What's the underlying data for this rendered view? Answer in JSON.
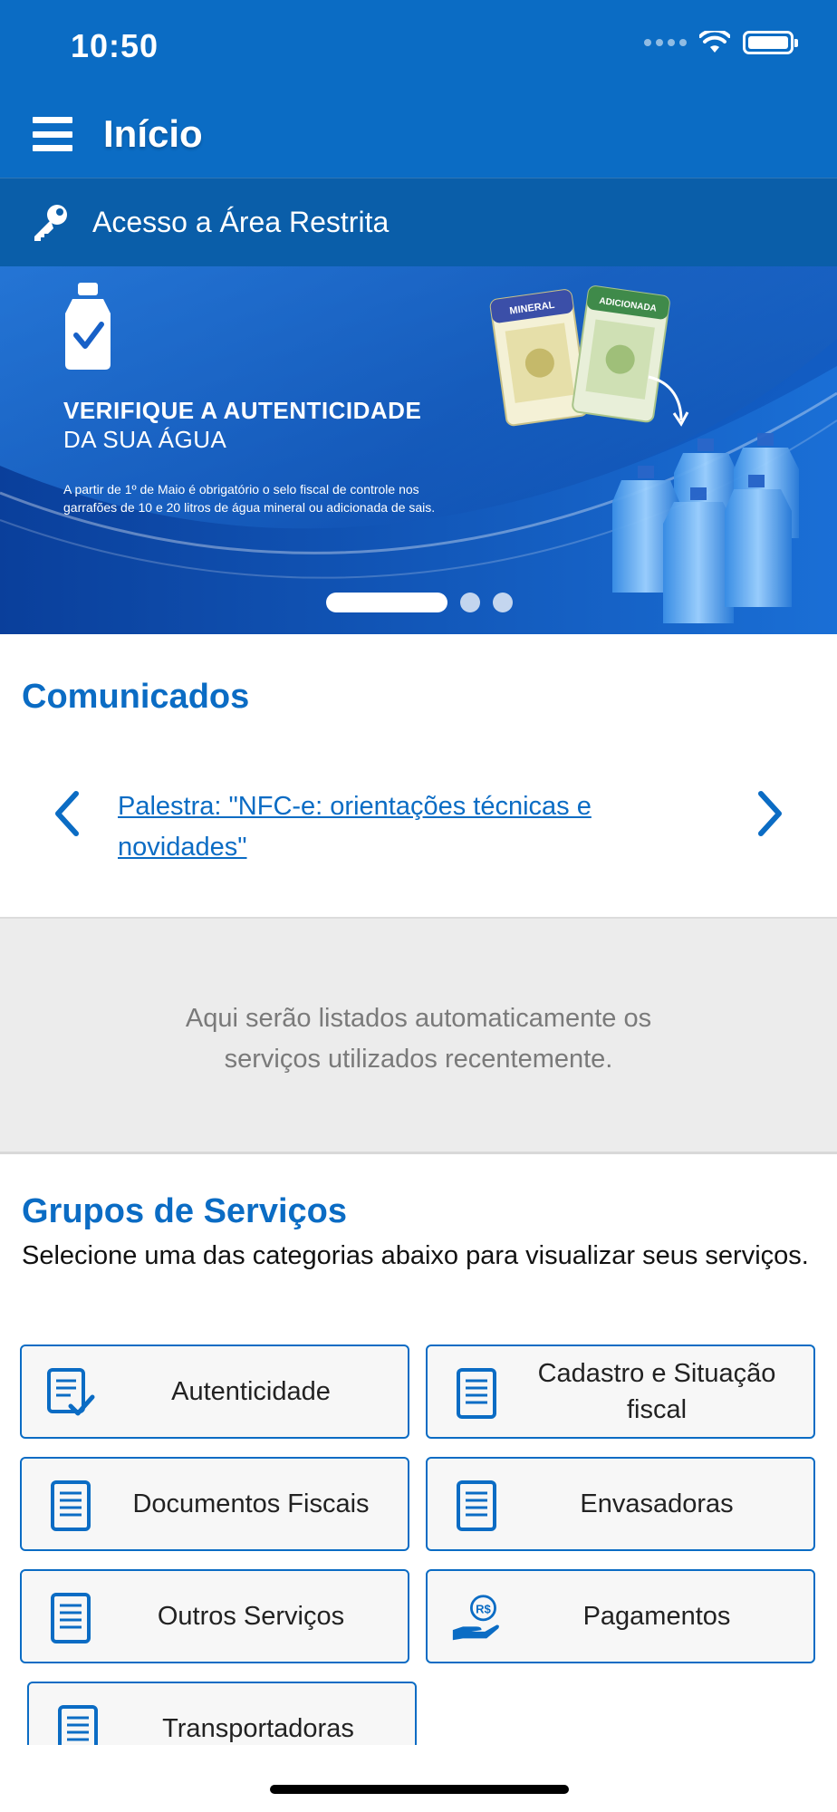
{
  "status": {
    "time": "10:50"
  },
  "nav": {
    "title": "Início"
  },
  "restricted": {
    "label": "Acesso a Área Restrita"
  },
  "banner": {
    "title_line1": "VERIFIQUE A AUTENTICIDADE",
    "title_line2": "DA SUA ÁGUA",
    "text": "A partir de 1º de Maio é obrigatório o selo fiscal de controle nos garrafões de 10 e 20 litros de água mineral ou adicionada de sais.",
    "stamp_left": "MINERAL",
    "stamp_right": "ADICIONADA",
    "active_slide": 1,
    "slide_count": 3
  },
  "comunicados": {
    "title": "Comunicados",
    "news_link": "Palestra: \"NFC-e: orientações técnicas e novidades\""
  },
  "recent": {
    "message": "Aqui serão listados automaticamente os serviços utilizados recentemente."
  },
  "grupos": {
    "title": "Grupos de Serviços",
    "subtitle": "Selecione uma das categorias abaixo para visualizar seus serviços.",
    "items": [
      {
        "label": "Autenticidade",
        "icon": "document-check-icon"
      },
      {
        "label": "Cadastro e Situação fiscal",
        "icon": "document-icon"
      },
      {
        "label": "Documentos Fiscais",
        "icon": "document-icon"
      },
      {
        "label": "Envasadoras",
        "icon": "document-icon"
      },
      {
        "label": "Outros Serviços",
        "icon": "document-icon"
      },
      {
        "label": "Pagamentos",
        "icon": "payment-hand-icon"
      },
      {
        "label": "Transportadoras",
        "icon": "document-icon"
      }
    ]
  },
  "colors": {
    "primary": "#0b6cc4",
    "header_dark": "#0a5ea9",
    "recent_bg": "#ececec"
  }
}
